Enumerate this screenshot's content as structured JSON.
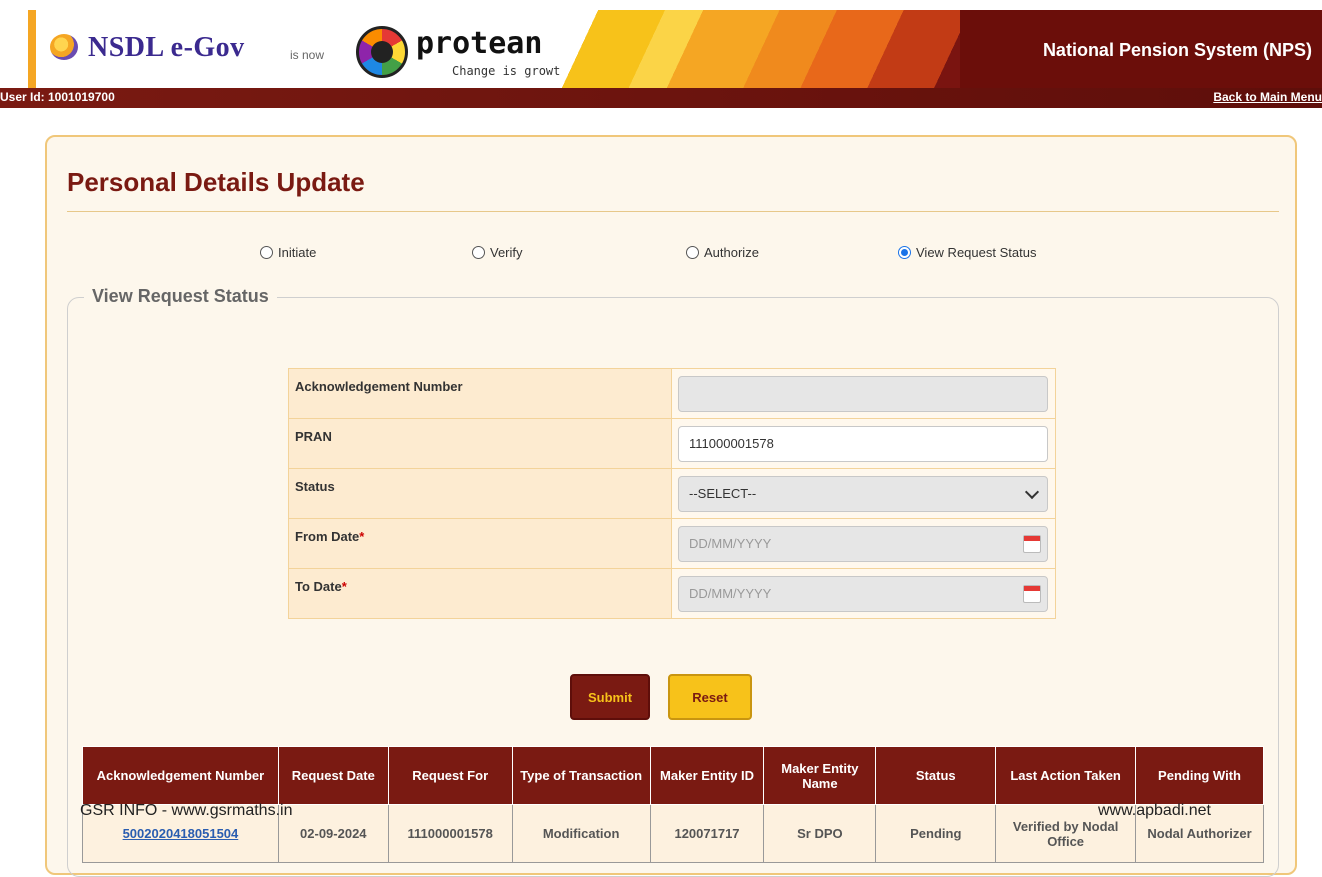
{
  "header": {
    "nsdl_brand": "NSDL e-Gov",
    "is_now": "is now",
    "protean_brand": "protean",
    "protean_tagline": "Change is growth",
    "system_title": "National Pension System (NPS)",
    "user_id": "User Id: 1001019700",
    "back_link": "Back to Main Menu"
  },
  "page": {
    "title": "Personal Details Update"
  },
  "radios": [
    {
      "label": "Initiate",
      "selected": false
    },
    {
      "label": "Verify",
      "selected": false
    },
    {
      "label": "Authorize",
      "selected": false
    },
    {
      "label": "View Request Status",
      "selected": true
    }
  ],
  "section": {
    "legend": "View Request Status"
  },
  "form": {
    "ack_label": "Acknowledgement Number",
    "ack_value": "",
    "pran_label": "PRAN",
    "pran_value": "111000001578",
    "status_label": "Status",
    "status_value": "--SELECT--",
    "from_label": "From Date",
    "from_placeholder": "DD/MM/YYYY",
    "to_label": "To Date",
    "to_placeholder": "DD/MM/YYYY",
    "required_mark": "*"
  },
  "buttons": {
    "submit": "Submit",
    "reset": "Reset"
  },
  "results": {
    "headers": [
      "Acknowledgement Number",
      "Request Date",
      "Request For",
      "Type of Transaction",
      "Maker Entity ID",
      "Maker Entity Name",
      "Status",
      "Last Action Taken",
      "Pending With"
    ],
    "rows": [
      [
        "5002020418051504",
        "02-09-2024",
        "111000001578",
        "Modification",
        "120071717",
        "Sr DPO",
        "Pending",
        "Verified by Nodal Office",
        "Nodal Authorizer"
      ]
    ]
  },
  "watermarks": {
    "left": "GSR INFO - www.gsrmaths.in",
    "right": "www.apbadi.net"
  },
  "colors": {
    "maroon": "#7a1a12",
    "gold": "#f7c21a",
    "panel_bg": "#fdf7ec"
  }
}
